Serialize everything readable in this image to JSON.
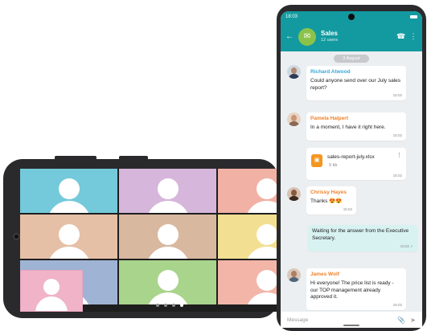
{
  "video_call": {
    "tile_colors": [
      "#74c9da",
      "#d6b6db",
      "#f2b1a5",
      "#e5c0a6",
      "#d9b8a0",
      "#f2df92",
      "#9fb3d4",
      "#a9d48c",
      "#f2b5a8"
    ],
    "self_view_color": "#f0b3c8",
    "pager": {
      "count": 4,
      "active_index": 3
    }
  },
  "chat": {
    "status_bar": {
      "time": "18:03"
    },
    "header": {
      "title": "Sales",
      "subtitle": "12 users",
      "back_icon": "arrow-left-icon",
      "call_icon": "phone-icon",
      "more_icon": "more-vertical-icon"
    },
    "date_chip": "3 August",
    "messages": [
      {
        "sender": "Richard Atwood",
        "sender_color": "#36a6d8",
        "text": "Could anyone send over our July sales report?",
        "time": "15:02"
      },
      {
        "sender": "Pamela Halpert",
        "sender_color": "#f2812a",
        "text": "In a moment, I have it right here.",
        "time": "15:02"
      },
      {
        "sender": "Chrissy Hayes",
        "sender_color": "#f2812a",
        "text": "Thanks 😍😍",
        "time": "15:02"
      },
      {
        "sender": "James Wolf",
        "sender_color": "#f2812a",
        "text": "Hi everyone! The price list is ready - our TOP management already approved it.",
        "time": "15:02"
      }
    ],
    "file": {
      "name": "sales-report-july.xlsx",
      "size": "9 kb",
      "time": "15:02"
    },
    "outgoing": {
      "text": "Waiting for the answer from the Executive Secretary.",
      "time": "15:02"
    },
    "input": {
      "placeholder": "Message"
    }
  }
}
